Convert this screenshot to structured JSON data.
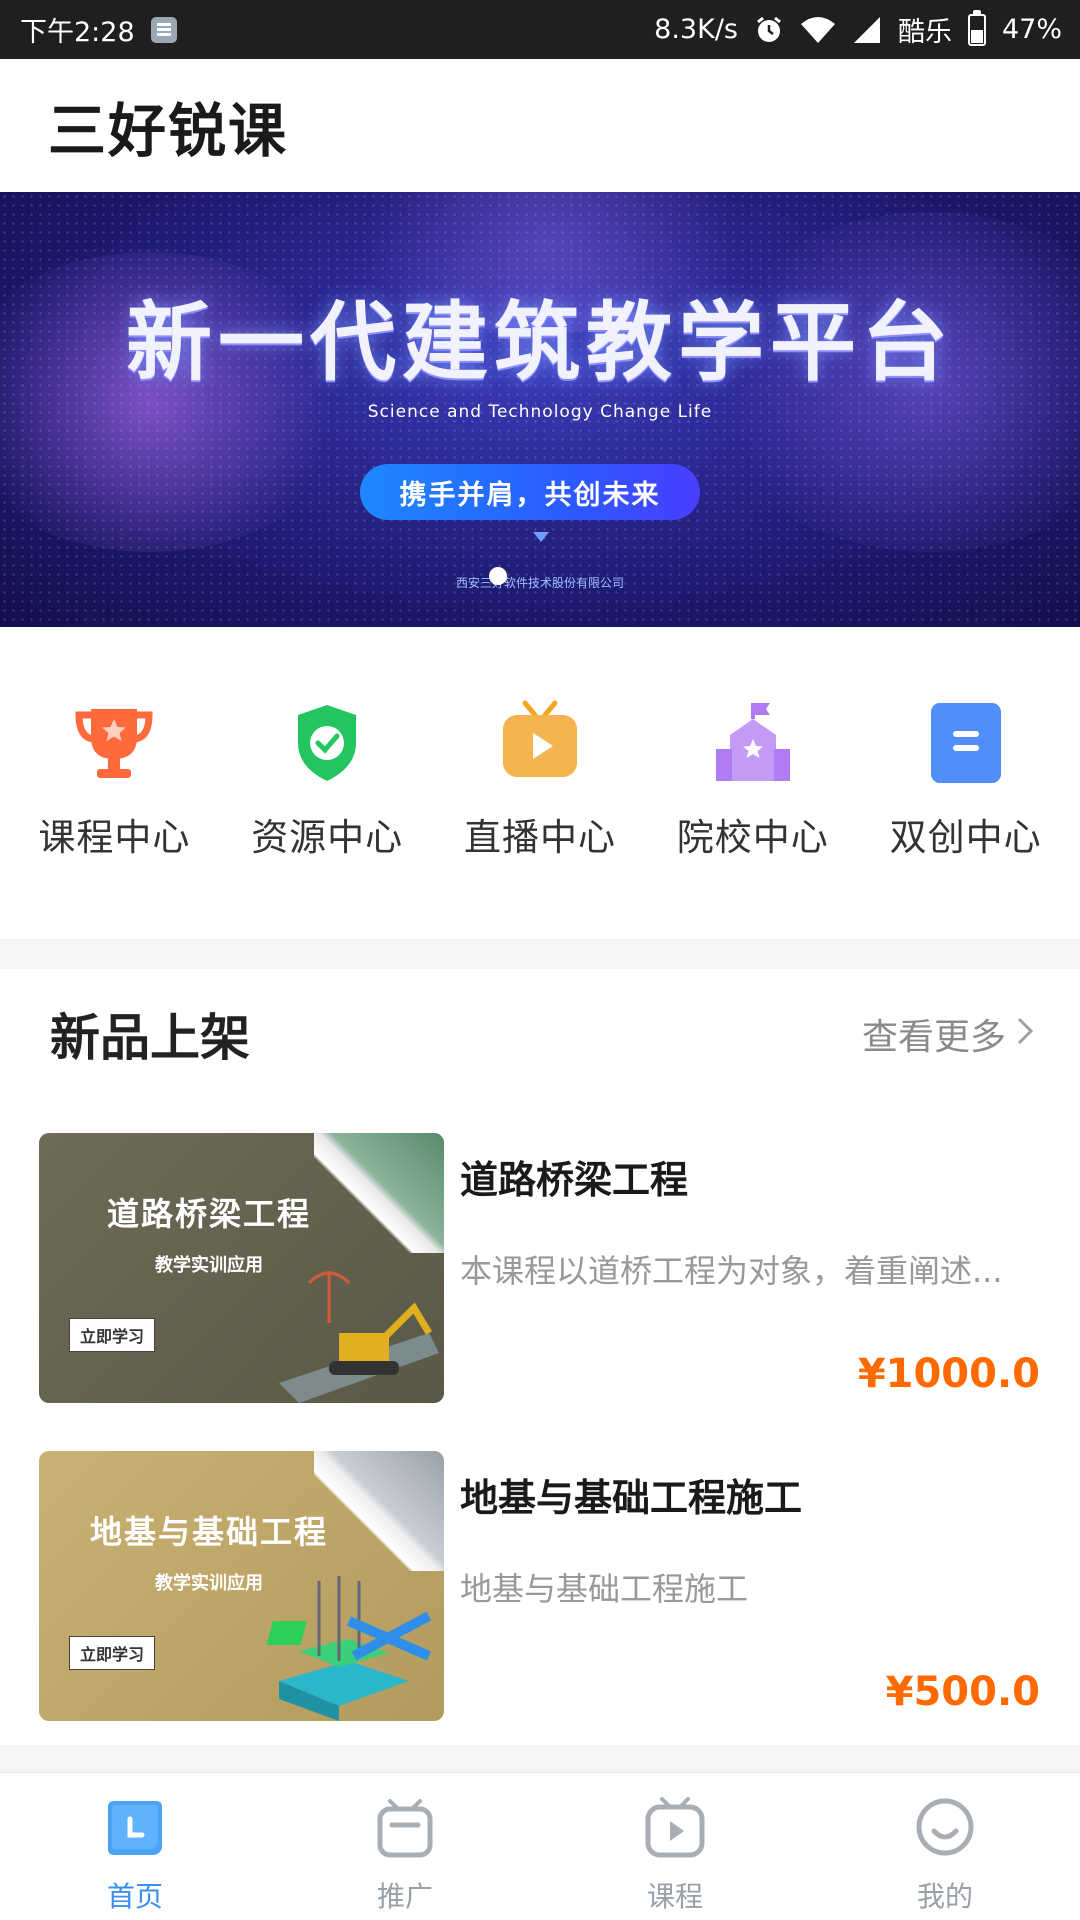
{
  "status_bar": {
    "time": "下午2:28",
    "net_speed": "8.3K/s",
    "carrier": "酷乐",
    "battery": "47%"
  },
  "header": {
    "title": "三好锐课"
  },
  "banner": {
    "title": "新一代建筑教学平台",
    "subtitle": "Science and Technology Change Life",
    "pill": "携手并肩，共创未来",
    "company": "西安三好软件技术股份有限公司",
    "active_slide": 1
  },
  "grid_nav": {
    "items": [
      {
        "label": "课程中心",
        "icon": "trophy-icon",
        "color": "#ff6a3d"
      },
      {
        "label": "资源中心",
        "icon": "shield-check-icon",
        "color": "#22c55e"
      },
      {
        "label": "直播中心",
        "icon": "tv-play-icon",
        "color": "#f5a623"
      },
      {
        "label": "院校中心",
        "icon": "school-icon",
        "color": "#b07cf5"
      },
      {
        "label": "双创中心",
        "icon": "document-icon",
        "color": "#4f8ff7"
      }
    ]
  },
  "section": {
    "title": "新品上架",
    "see_more": "查看更多"
  },
  "courses": [
    {
      "thumb_title": "道路桥梁工程",
      "thumb_sub": "教学实训应用",
      "thumb_btn": "立即学习",
      "name": "道路桥梁工程",
      "desc": "本课程以道桥工程为对象，着重阐述...",
      "price": "¥1000.0"
    },
    {
      "thumb_title": "地基与基础工程",
      "thumb_sub": "教学实训应用",
      "thumb_btn": "立即学习",
      "name": "地基与基础工程施工",
      "desc": "地基与基础工程施工",
      "price": "¥500.0"
    }
  ],
  "tab_bar": {
    "tabs": [
      {
        "label": "首页",
        "icon": "home-icon",
        "active": true
      },
      {
        "label": "推广",
        "icon": "promote-icon",
        "active": false
      },
      {
        "label": "课程",
        "icon": "course-tv-icon",
        "active": false
      },
      {
        "label": "我的",
        "icon": "profile-icon",
        "active": false
      }
    ],
    "active_color": "#3a8ff0",
    "inactive_color": "#9aa0a8"
  }
}
